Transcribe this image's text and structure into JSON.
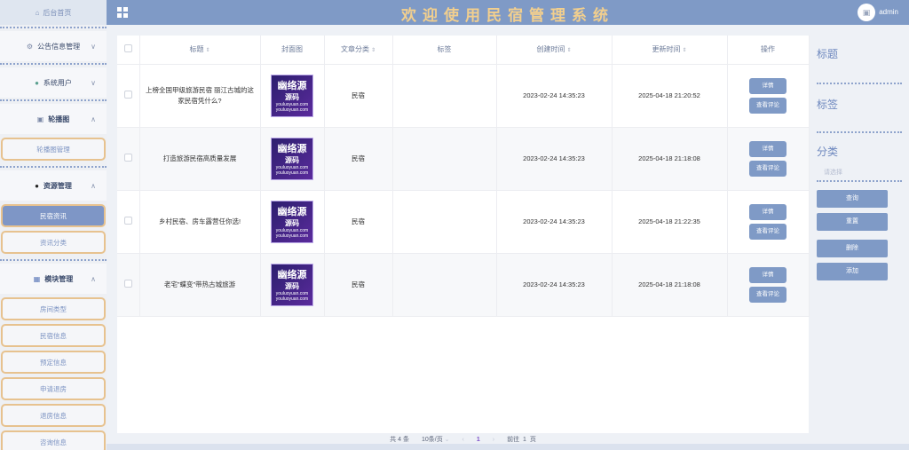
{
  "header": {
    "title": "欢迎使用民宿管理系统",
    "username": "admin"
  },
  "sidebar": {
    "home": "后台首页",
    "groups": [
      {
        "label": "公告信息管理",
        "items": []
      },
      {
        "label": "系统用户",
        "items": []
      },
      {
        "label": "轮播图",
        "items": [
          "轮播图管理"
        ]
      },
      {
        "label": "资源管理",
        "items": [
          "民宿资讯",
          "资讯分类"
        ]
      },
      {
        "label": "模块管理",
        "items": [
          "房间类型",
          "民宿信息",
          "预定信息",
          "申请退房",
          "退房信息",
          "咨询信息"
        ]
      }
    ]
  },
  "table": {
    "headers": [
      "标题",
      "封面图",
      "文章分类",
      "标签",
      "创建时间",
      "更新时间",
      "操作"
    ],
    "cover_text": {
      "big": "幽络源",
      "mid": "源码",
      "site1": "youluoyuan.com",
      "site2": "youluoyuan.com"
    },
    "rows": [
      {
        "title": "上榜全国甲级旅游民宿 丽江古城的这家民宿凭什么?",
        "category": "民宿",
        "tag": "",
        "created": "2023-02-24 14:35:23",
        "updated": "2025-04-18 21:20:52"
      },
      {
        "title": "打造旅游民宿高质量发展",
        "category": "民宿",
        "tag": "",
        "created": "2023-02-24 14:35:23",
        "updated": "2025-04-18 21:18:08"
      },
      {
        "title": "乡村民宿、房车露营任你选!",
        "category": "民宿",
        "tag": "",
        "created": "2023-02-24 14:35:23",
        "updated": "2025-04-18 21:22:35"
      },
      {
        "title": "老宅\"蝶变\"带热古城旅游",
        "category": "民宿",
        "tag": "",
        "created": "2023-02-24 14:35:23",
        "updated": "2025-04-18 21:18:08"
      }
    ],
    "detail_label": "详情",
    "comment_label": "查看评论"
  },
  "pager": {
    "total": "共 4 条",
    "size": "10条/页",
    "current": "1",
    "goto_label": "前往",
    "goto_value": "1",
    "page_unit": "页"
  },
  "search": {
    "title_label": "标题",
    "tag_label": "标签",
    "category_label": "分类",
    "category_placeholder": "请选择",
    "query": "查询",
    "reset": "重置",
    "delete": "删除",
    "add": "添加"
  }
}
